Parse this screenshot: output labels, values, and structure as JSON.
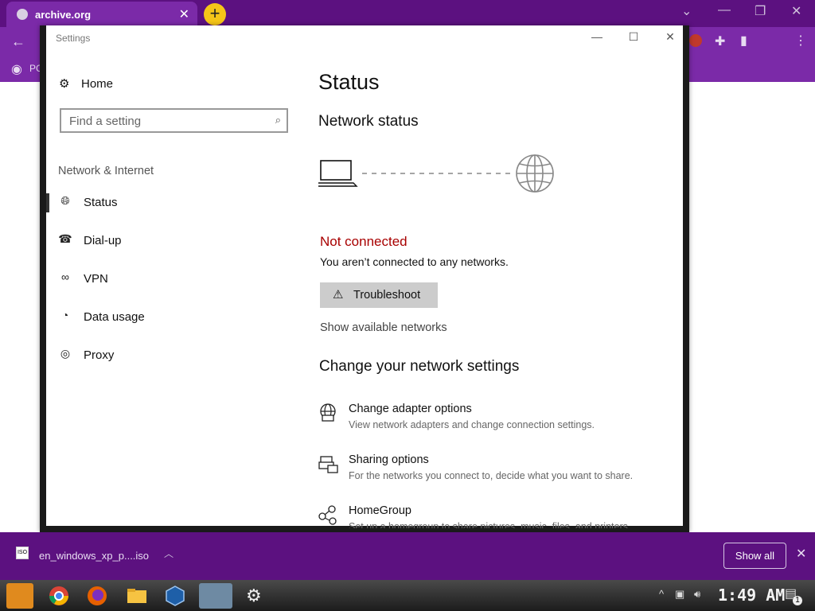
{
  "browser": {
    "tab_title": "archive.org",
    "new_tab": "+",
    "bookmark_stub": "PC"
  },
  "settings": {
    "window_title": "Settings",
    "home_label": "Home",
    "search_placeholder": "Find a setting",
    "section_heading": "Network & Internet",
    "nav_items": [
      {
        "label": "Status",
        "icon": "globe-status-icon"
      },
      {
        "label": "Dial-up",
        "icon": "dial-up-icon"
      },
      {
        "label": "VPN",
        "icon": "vpn-icon"
      },
      {
        "label": "Data usage",
        "icon": "data-usage-icon"
      },
      {
        "label": "Proxy",
        "icon": "globe-icon"
      }
    ],
    "page_title": "Status",
    "network_status_heading": "Network status",
    "not_connected": "Not connected",
    "not_connected_desc": "You aren’t connected to any networks.",
    "troubleshoot_label": "Troubleshoot",
    "show_networks": "Show available networks",
    "change_heading": "Change your network settings",
    "options": [
      {
        "title": "Change adapter options",
        "desc": "View network adapters and change connection settings.",
        "icon": "adapter-icon"
      },
      {
        "title": "Sharing options",
        "desc": "For the networks you connect to, decide what you want to share.",
        "icon": "sharing-icon"
      },
      {
        "title": "HomeGroup",
        "desc": "Set up a homegroup to share pictures, music, files, and printers.",
        "icon": "homegroup-icon"
      }
    ],
    "error_color": "#a80000"
  },
  "downloads": {
    "file_name": "en_windows_xp_p....iso",
    "file_badge": "ISO",
    "show_all": "Show all"
  },
  "taskbar": {
    "clock": "1:49 AM",
    "notification_count": "1"
  }
}
